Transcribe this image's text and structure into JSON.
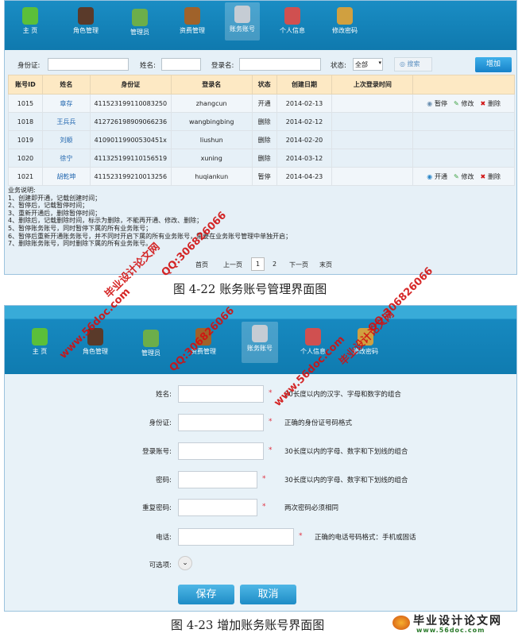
{
  "nav": {
    "items": [
      {
        "label": "主 页",
        "icon": "home-icon"
      },
      {
        "label": "角色管理",
        "icon": "role-icon"
      },
      {
        "label": "管理员",
        "icon": "admin-icon"
      },
      {
        "label": "资费管理",
        "icon": "fee-icon"
      },
      {
        "label": "账务账号",
        "icon": "clipboard-icon"
      },
      {
        "label": "个人信息",
        "icon": "users-icon"
      },
      {
        "label": "修改密码",
        "icon": "lock-user-icon"
      }
    ],
    "active": "账务账号"
  },
  "search": {
    "id_label": "身份证:",
    "name_label": "姓名:",
    "login_label": "登录名:",
    "status_label": "状态:",
    "status_value": "全部",
    "search_button": "搜索",
    "add_button": "增加"
  },
  "table": {
    "headers": [
      "账号ID",
      "姓名",
      "身份证",
      "登录名",
      "状态",
      "创建日期",
      "上次登录时间",
      ""
    ],
    "rows": [
      {
        "id": "1015",
        "name": "章存",
        "idcard": "411523199110083250",
        "login": "zhangcun",
        "status": "开通",
        "created": "2014-02-13",
        "last": "",
        "ops": [
          "暂停",
          "修改",
          "删除"
        ]
      },
      {
        "id": "1018",
        "name": "王兵兵",
        "idcard": "412726198909066236",
        "login": "wangbingbing",
        "status": "删除",
        "created": "2014-02-12",
        "last": "",
        "ops": []
      },
      {
        "id": "1019",
        "name": "刘顺",
        "idcard": "41090119900530451x",
        "login": "liushun",
        "status": "删除",
        "created": "2014-02-20",
        "last": "",
        "ops": []
      },
      {
        "id": "1020",
        "name": "徐宁",
        "idcard": "411325199110156519",
        "login": "xuning",
        "status": "删除",
        "created": "2014-03-12",
        "last": "",
        "ops": []
      },
      {
        "id": "1021",
        "name": "胡乾坤",
        "idcard": "411523199210013256",
        "login": "huqiankun",
        "status": "暂停",
        "created": "2014-04-23",
        "last": "",
        "ops": [
          "开通",
          "修改",
          "删除"
        ]
      }
    ]
  },
  "notes": [
    "业务说明:",
    "1、创建即开通，记载创建时间；",
    "2、暂停后，记载暂停时间；",
    "3、重新开通后，删除暂停时间；",
    "4、删除后，记载删除时间，标示为删除，不能再开通、修改、删除；",
    "5、暂停账务账号，同时暂停下属的所有业务账号；",
    "6、暂停后重新开通账务账号，并不同时开启下属的所有业务账号，需要在业务账号管理中单独开启；",
    "7、删除账务账号，同时删除下属的所有业务账号。"
  ],
  "pager": {
    "first": "首页",
    "prev": "上一页",
    "pages": [
      "1",
      "2"
    ],
    "current": "1",
    "next": "下一页",
    "last": "末页"
  },
  "caption1": "图 4-22 账务账号管理界面图",
  "form": {
    "fields": [
      {
        "label": "姓名:",
        "hint": "20长度以内的汉字、字母和数字的组合"
      },
      {
        "label": "身份证:",
        "hint": "正确的身份证号码格式"
      },
      {
        "label": "登录账号:",
        "hint": "30长度以内的字母、数字和下划线的组合"
      },
      {
        "label": "密码:",
        "hint": "30长度以内的字母、数字和下划线的组合"
      },
      {
        "label": "重复密码:",
        "hint": "两次密码必须相同"
      },
      {
        "label": "电话:",
        "hint": "正确的电话号码格式：手机或固话"
      }
    ],
    "required_mark": "*",
    "optional_label": "可选项:",
    "save": "保存",
    "cancel": "取消"
  },
  "caption2": "图 4-23 增加账务账号界面图",
  "watermark": {
    "site": "www.56doc.com",
    "qq": "QQ:306826066",
    "name": "毕业设计论文网"
  },
  "logo": {
    "name": "毕业设计论文网",
    "url": "www.56doc.com"
  }
}
